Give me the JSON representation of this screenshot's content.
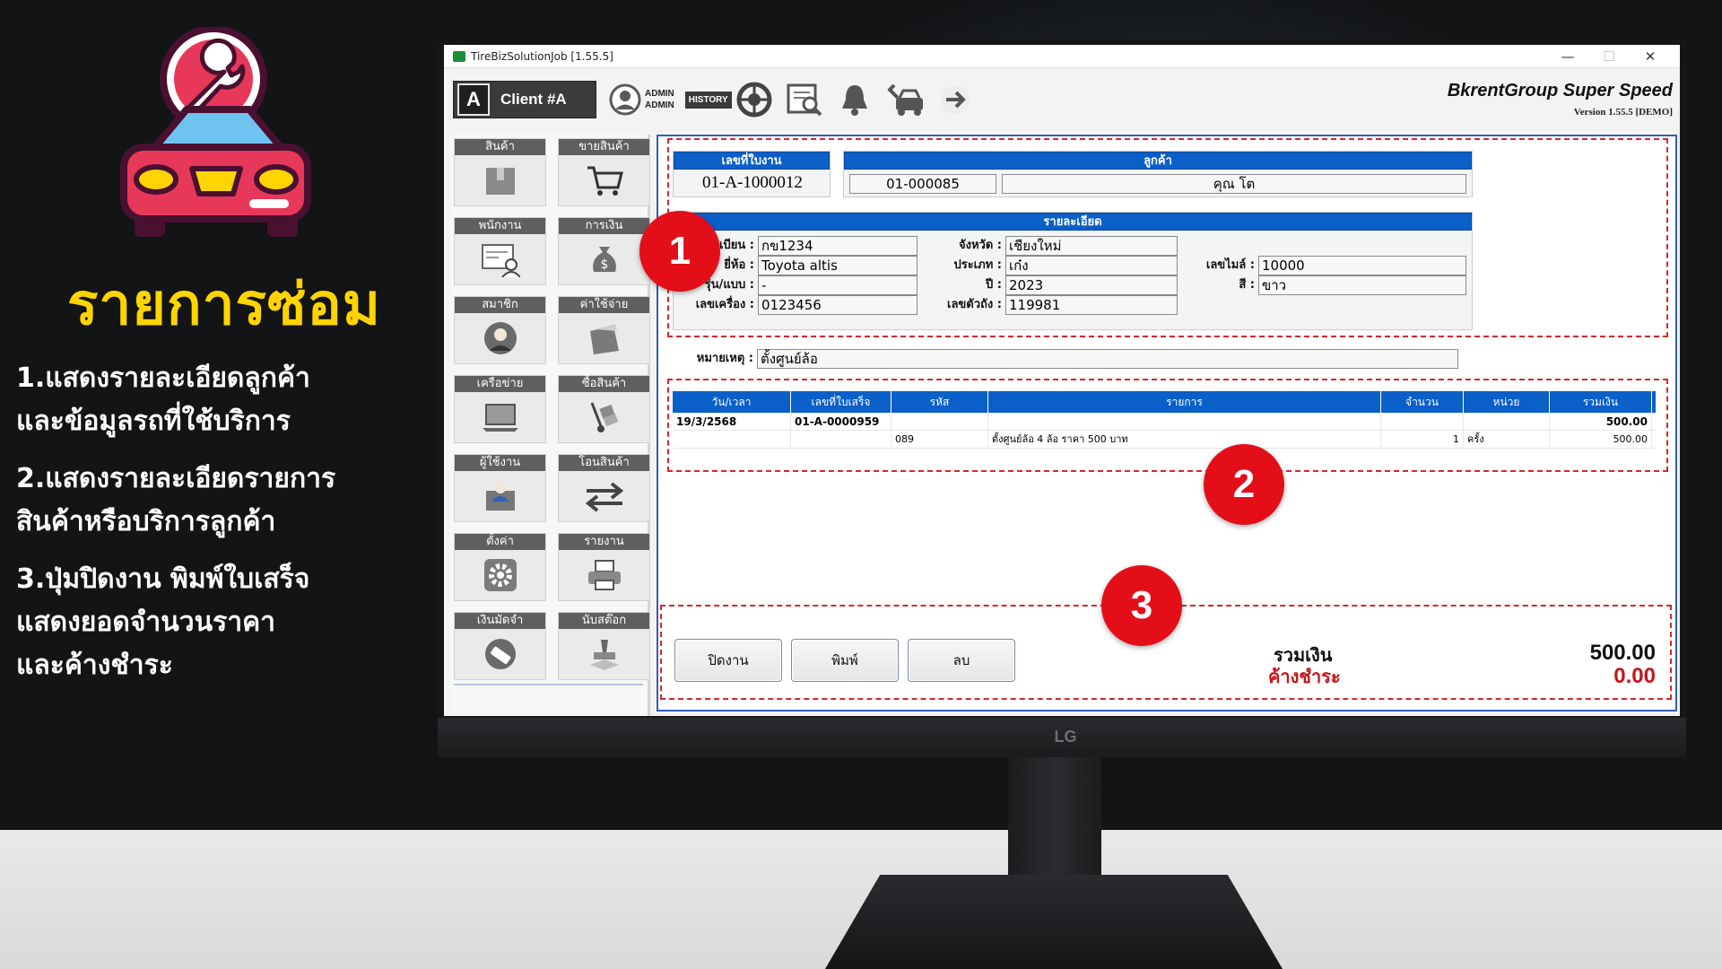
{
  "promo": {
    "title": "รายการซ่อม",
    "lines": [
      "1.แสดงรายละเอียดลูกค้า",
      "และข้อมูลรถที่ใช้บริการ",
      "2.แสดงรายละเอียดรายการ",
      "สินค้าหรือบริการลูกค้า",
      "3.ปุ่มปิดงาน พิมพ์ใบเสร็จ",
      "แสดงยอดจำนวนราคา",
      "และค้างชำระ"
    ]
  },
  "monitor": {
    "brand": "LG"
  },
  "window": {
    "title": "TireBizSolutionJob [1.55.5]",
    "controls": [
      "—",
      "☐",
      "✕"
    ]
  },
  "toolbar": {
    "client_letter": "A",
    "client_label": "Client #A",
    "user_line1": "ADMIN",
    "user_line2": "ADMIN",
    "history_label": "HISTORY"
  },
  "brand": {
    "name": "BkrentGroup Super Speed",
    "version": "Version 1.55.5 [DEMO]"
  },
  "sidebar": {
    "items": [
      {
        "label": "สินค้า"
      },
      {
        "label": "ขายสินค้า"
      },
      {
        "label": "พนักงาน"
      },
      {
        "label": "การเงิน"
      },
      {
        "label": "สมาชิก"
      },
      {
        "label": "ค่าใช้จ่าย"
      },
      {
        "label": "เครือข่าย"
      },
      {
        "label": "ซื้อสินค้า"
      },
      {
        "label": "ผู้ใช้งาน"
      },
      {
        "label": "โอนสินค้า"
      },
      {
        "label": "ตั้งค่า"
      },
      {
        "label": "รายงาน"
      },
      {
        "label": "เงินมัดจำ"
      },
      {
        "label": "นับสต๊อก"
      }
    ]
  },
  "job": {
    "header": "เลขที่ใบงาน",
    "number": "01-A-1000012"
  },
  "customer": {
    "header": "ลูกค้า",
    "code": "01-000085",
    "name": "คุณ โต"
  },
  "details": {
    "header": "รายละเอียด",
    "plate_label": "ทะเบียน :",
    "plate": "กข1234",
    "brand_label": "ยี่ห้อ :",
    "brand": "Toyota altis",
    "model_label": "รุ่น/แบบ :",
    "model": "-",
    "engine_label": "เลขเครื่อง :",
    "engine": "0123456",
    "province_label": "จังหวัด :",
    "province": "เชียงใหม่",
    "type_label": "ประเภท :",
    "type": "เก๋ง",
    "year_label": "ปี :",
    "year": "2023",
    "chassis_label": "เลขตัวถัง :",
    "chassis": "119981",
    "mileage_label": "เลขไมล์ :",
    "mileage": "10000",
    "color_label": "สี :",
    "color": "ขาว",
    "note_label": "หมายเหตุ :",
    "note": "ตั้งศูนย์ล้อ"
  },
  "table": {
    "headers": [
      "วัน/เวลา",
      "เลขที่ใบเสร็จ",
      "รหัส",
      "รายการ",
      "จำนวน",
      "หน่วย",
      "รวมเงิน"
    ],
    "group": {
      "date": "19/3/2568",
      "receipt": "01-A-0000959",
      "total": "500.00"
    },
    "rows": [
      {
        "code": "089",
        "item": "ตั้งศูนย์ล้อ 4 ล้อ ราคา 500 บาท",
        "qty": "1",
        "unit": "ครั้ง",
        "amount": "500.00"
      }
    ]
  },
  "actions": {
    "close_job": "ปิดงาน",
    "print": "พิมพ์",
    "delete": "ลบ"
  },
  "totals": {
    "total_label": "รวมเงิน",
    "total": "500.00",
    "outstanding_label": "ค้างชำระ",
    "outstanding": "0.00"
  },
  "badges": [
    "1",
    "2",
    "3"
  ],
  "colors": {
    "header_blue": "#0a5fc8",
    "promo_yellow": "#ffd400",
    "badge_red": "#e40e18",
    "outstanding_red": "#c8141b",
    "dash_red": "#d8262b"
  }
}
